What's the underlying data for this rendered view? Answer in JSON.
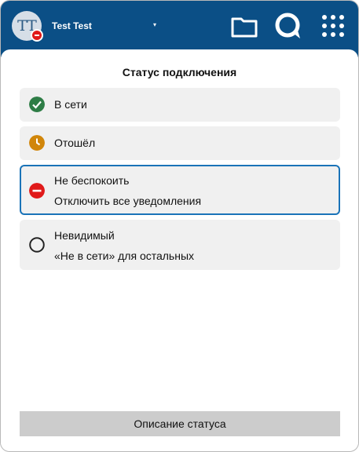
{
  "header": {
    "avatar_initials": "TT",
    "user_name": "Test Test",
    "chevron": "▾",
    "icons": [
      "folder-icon",
      "search-chat-icon",
      "apps-grid-icon"
    ],
    "accent_color": "#0b4f86"
  },
  "panel": {
    "title": "Статус подключения",
    "statuses": [
      {
        "label": "В сети",
        "sub": "",
        "icon": "check-circle-icon",
        "color": "#2e7d46",
        "selected": false
      },
      {
        "label": "Отошёл",
        "sub": "",
        "icon": "clock-icon",
        "color": "#d1860a",
        "selected": false
      },
      {
        "label": "Не беспокоить",
        "sub": "Отключить все уведомления",
        "icon": "minus-circle-icon",
        "color": "#e01a1a",
        "selected": true
      },
      {
        "label": "Невидимый",
        "sub": "«Не в сети» для остальных",
        "icon": "empty-circle-icon",
        "color": "#222222",
        "selected": false
      }
    ],
    "footer_button": "Описание статуса"
  }
}
